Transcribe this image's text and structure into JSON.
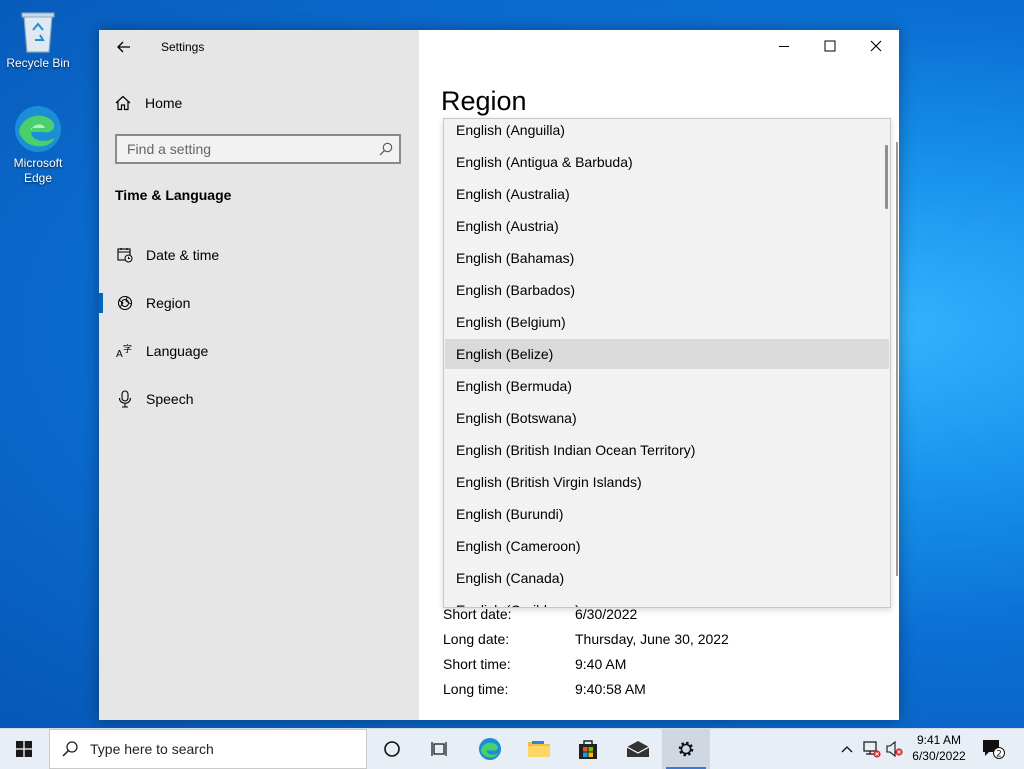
{
  "desktop": {
    "icons": [
      {
        "label": "Recycle Bin",
        "icon": "recycle-bin-icon"
      },
      {
        "label": "Microsoft Edge",
        "icon": "edge-icon"
      }
    ]
  },
  "window": {
    "title": "Settings",
    "nav": {
      "home_label": "Home",
      "search_placeholder": "Find a setting",
      "section_title": "Time & Language",
      "items": [
        {
          "label": "Date & time",
          "icon": "calendar-clock-icon"
        },
        {
          "label": "Region",
          "icon": "globe-icon",
          "selected": true
        },
        {
          "label": "Language",
          "icon": "language-icon"
        },
        {
          "label": "Speech",
          "icon": "microphone-icon"
        }
      ]
    },
    "content": {
      "page_title": "Region",
      "formats": [
        {
          "label": "Short date:",
          "value": "6/30/2022"
        },
        {
          "label": "Long date:",
          "value": "Thursday, June 30, 2022"
        },
        {
          "label": "Short time:",
          "value": "9:40 AM"
        },
        {
          "label": "Long time:",
          "value": "9:40:58 AM"
        }
      ]
    },
    "dropdown_options": [
      "English (Anguilla)",
      "English (Antigua & Barbuda)",
      "English (Australia)",
      "English (Austria)",
      "English (Bahamas)",
      "English (Barbados)",
      "English (Belgium)",
      "English (Belize)",
      "English (Bermuda)",
      "English (Botswana)",
      "English (British Indian Ocean Territory)",
      "English (British Virgin Islands)",
      "English (Burundi)",
      "English (Cameroon)",
      "English (Canada)",
      "English (Caribbean)"
    ],
    "dropdown_highlighted": "English (Belize)"
  },
  "taskbar": {
    "search_placeholder": "Type here to search",
    "clock_time": "9:41 AM",
    "clock_date": "6/30/2022",
    "notification_count": "2",
    "accent": "#0067c0"
  }
}
